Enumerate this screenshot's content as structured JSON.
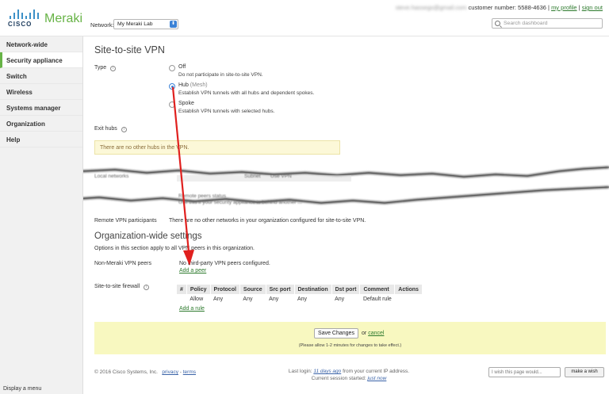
{
  "header": {
    "logo_cisco": "CISCO",
    "logo_meraki": "Meraki",
    "network_label": "Network:",
    "network_value": "My Meraki Lab",
    "account_email": "steve.hassegs@gmail.com",
    "customer_number": "customer number: 5588-4636",
    "separator": "|",
    "my_profile": "my profile",
    "sign_out": "sign out",
    "search_placeholder": "Search dashboard"
  },
  "sidebar": {
    "items": [
      {
        "label": "Network-wide",
        "active": false
      },
      {
        "label": "Security appliance",
        "active": true
      },
      {
        "label": "Switch",
        "active": false
      },
      {
        "label": "Wireless",
        "active": false
      },
      {
        "label": "Systems manager",
        "active": false
      },
      {
        "label": "Organization",
        "active": false
      },
      {
        "label": "Help",
        "active": false
      }
    ],
    "display_menu": "Display a menu"
  },
  "main": {
    "title": "Site-to-site VPN",
    "type_label": "Type",
    "type_options": [
      {
        "title": "Off",
        "sub": "",
        "desc": "Do not participate in site-to-site VPN.",
        "checked": false
      },
      {
        "title": "Hub",
        "sub": "(Mesh)",
        "desc": "Establish VPN tunnels with all hubs and dependent spokes.",
        "checked": true
      },
      {
        "title": "Spoke",
        "sub": "",
        "desc": "Establish VPN tunnels with selected hubs.",
        "checked": false
      }
    ],
    "exit_hubs_label": "Exit hubs",
    "exit_hubs_notice": "There are no other hubs in the VPN.",
    "torn": {
      "local_networks": "Local networks",
      "subnet": "Subnet",
      "use_vpn": "Use VPN",
      "remote_peers": "Remote peers status",
      "remote_peers_desc": "Use this if your security appliance is behind another ...",
      "obscured_value": "..."
    },
    "remote_participants_label": "Remote VPN participants",
    "remote_participants_value": "There are no other networks in your organization configured for site-to-site VPN.",
    "org_title": "Organization-wide settings",
    "org_desc": "Options in this section apply to all VPN peers in this organization.",
    "peers_label": "Non-Meraki VPN peers",
    "peers_value": "No third-party VPN peers configured.",
    "add_peer": "Add a peer",
    "firewall_label": "Site-to-site firewall",
    "firewall": {
      "headers": [
        "#",
        "Policy",
        "Protocol",
        "Source",
        "Src port",
        "Destination",
        "Dst port",
        "Comment",
        "Actions"
      ],
      "rows": [
        [
          "",
          "Allow",
          "Any",
          "Any",
          "Any",
          "Any",
          "Any",
          "Default rule",
          ""
        ]
      ]
    },
    "add_rule": "Add a rule",
    "save_button": "Save Changes",
    "or_text": "or",
    "cancel": "cancel",
    "save_note": "(Please allow 1-2 minutes for changes to take effect.)"
  },
  "footer": {
    "copyright": "© 2016 Cisco Systems, Inc.",
    "privacy": "privacy",
    "dash": "-",
    "terms": "terms",
    "last_login_prefix": "Last login:",
    "last_login_time": "11 days ago",
    "last_login_suffix": "from your current IP address.",
    "session_prefix": "Current session started:",
    "session_time": "just now",
    "wish_placeholder": "I wish this page would...",
    "wish_button": "make a wish"
  },
  "colors": {
    "accent_green": "#67b346",
    "link_green": "#2d7a2d",
    "annotation_arrow": "#e0201e",
    "radio_blue": "#3b82d6",
    "save_bar": "#f8f8c0"
  }
}
